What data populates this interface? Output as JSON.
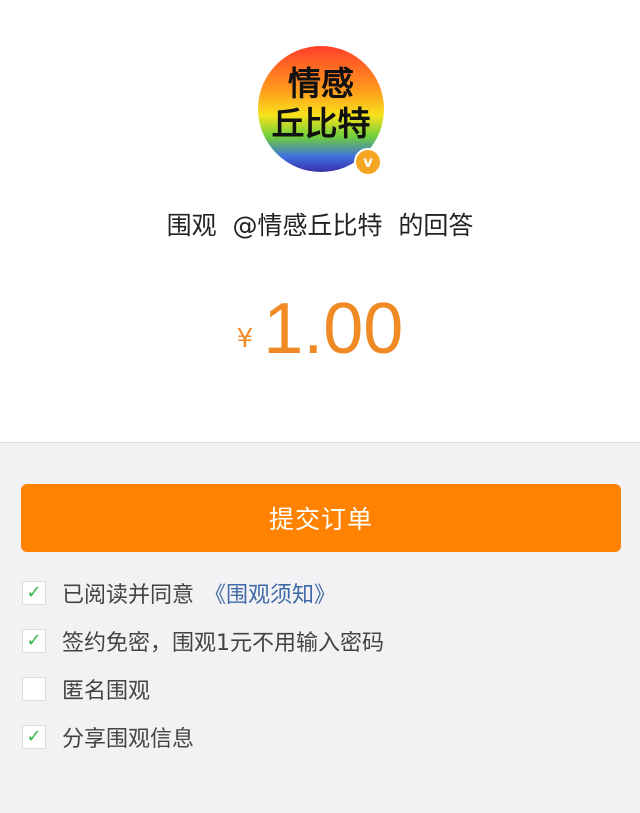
{
  "header": {
    "avatar_line1": "情感",
    "avatar_line2": "丘比特",
    "verified_badge": "v",
    "title": "围观  @情感丘比特  的回答"
  },
  "price": {
    "currency": "¥",
    "amount": "1.00"
  },
  "actions": {
    "submit_label": "提交订单"
  },
  "options": [
    {
      "label": "已阅读并同意",
      "link": "《围观须知》",
      "checked": true
    },
    {
      "label": "签约免密，围观1元不用输入密码",
      "checked": true
    },
    {
      "label": "匿名围观",
      "checked": false
    },
    {
      "label": "分享围观信息",
      "checked": true
    }
  ],
  "colors": {
    "accent": "#ff8200",
    "price": "#f08a24",
    "check": "#36b34a",
    "link": "#3f6aa8"
  }
}
